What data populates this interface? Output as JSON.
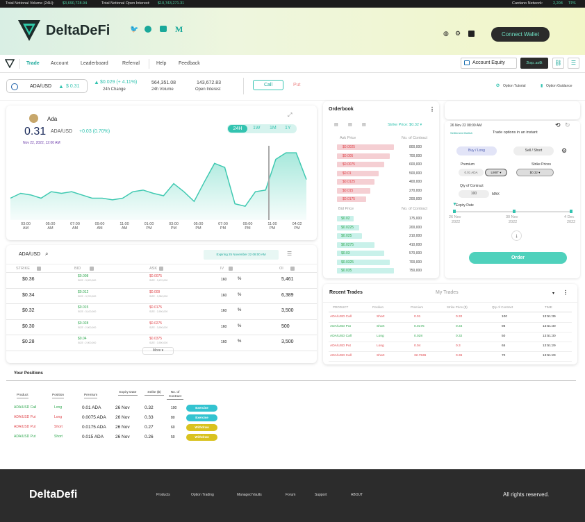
{
  "topbar": {
    "vol_label": "Total Notional Volume (24H):",
    "vol_value": "$3,690,728.94",
    "oi_label": "Total Notional Open Interest:",
    "oi_value": "$10,743,271.31",
    "network_label": "Cardano Network:",
    "tps_value": "2,208",
    "tps_label": "TPS"
  },
  "hero": {
    "brand": "DeltaDeFi",
    "connect": "Connect Wallet"
  },
  "nav": {
    "items": [
      "Trade",
      "Account",
      "Leaderboard",
      "Referral",
      "Help",
      "Feedback"
    ],
    "account_equity": "Account Equity",
    "wallet": "2kxp..ao8t"
  },
  "ticker": {
    "pair": "ADA/USD",
    "price": "$ 0.31",
    "change": "$0.029 (+ 4.11%)",
    "change_label": "24h Change",
    "volume": "564,351.08",
    "volume_label": "24h Volume",
    "oi": "143,672.83",
    "oi_label": "Open Interest",
    "call": "Call",
    "put": "Put",
    "tutorial": "Option Tutorial",
    "guidance": "Option Guidance"
  },
  "price_chart": {
    "asset": "Ada",
    "price": "0.31",
    "pair": "ADA/USD",
    "delta": "+0.03 (0.70%)",
    "date": "Nov 22, 2022, 12:00 AM",
    "ranges": [
      "24H",
      "1W",
      "1M",
      "1Y"
    ]
  },
  "chart_data": {
    "type": "area",
    "x": [
      "03:00 AM",
      "05:00 AM",
      "07:00 AM",
      "09:00 AM",
      "11:00 AM",
      "01:00 PM",
      "03:00 PM",
      "05:00 PM",
      "07:00 PM",
      "09:00 PM",
      "11:00 PM",
      "04:02 PM"
    ],
    "values": [
      0.262,
      0.268,
      0.266,
      0.262,
      0.27,
      0.268,
      0.27,
      0.266,
      0.262,
      0.262,
      0.26,
      0.262,
      0.27,
      0.272,
      0.268,
      0.265,
      0.28,
      0.27,
      0.258,
      0.282,
      0.305,
      0.3,
      0.255,
      0.252,
      0.27,
      0.272,
      0.31,
      0.318,
      0.318,
      0.285
    ],
    "series": []
  },
  "options": {
    "pair": "ADA/USD",
    "expiry": "Expiring 25 November 22 08:00 AM",
    "headers": [
      "STRIKE",
      "BID",
      "ASK",
      "IV",
      "OI"
    ],
    "rows": [
      {
        "strike": "$0.36",
        "bid": "$0.008",
        "bid_size": "SIZE : 3,200,000",
        "ask": "$0.0075",
        "ask_size": "SIZE : 3,470,000",
        "iv": "160",
        "pct": "%",
        "oi": "5,461"
      },
      {
        "strike": "$0.34",
        "bid": "$0.012",
        "bid_size": "SIZE : 3,700,000",
        "ask": "$0.009",
        "ask_size": "SIZE : 3,350,000",
        "iv": "160",
        "pct": "%",
        "oi": "6,389"
      },
      {
        "strike": "$0.32",
        "bid": "$0.015",
        "bid_size": "SIZE : 3,100,000",
        "ask": "$0.0175",
        "ask_size": "SIZE : 2,900,000",
        "iv": "160",
        "pct": "%",
        "oi": "3,500"
      },
      {
        "strike": "$0.30",
        "bid": "$0.028",
        "bid_size": "SIZE : 2,900,000",
        "ask": "$0.0275",
        "ask_size": "SIZE : 3,900,000",
        "iv": "160",
        "pct": "%",
        "oi": "500"
      },
      {
        "strike": "$0.28",
        "bid": "$0.04",
        "bid_size": "SIZE : 2,900,000",
        "ask": "$0.0375",
        "ask_size": "SIZE : 3,900,000",
        "iv": "160",
        "pct": "%",
        "oi": "3,500"
      }
    ],
    "more": "More"
  },
  "orderbook": {
    "title": "Orderbook",
    "strike": "Strike Price: $0.32",
    "ask_header": "Ask Price",
    "contract_header": "No. of Contract",
    "bid_header": "Bid Price",
    "asks": [
      {
        "p": "$0.0025",
        "n": "800,000",
        "w": 82
      },
      {
        "p": "$0.005",
        "n": "700,000",
        "w": 76
      },
      {
        "p": "$0.0075",
        "n": "600,000",
        "w": 68
      },
      {
        "p": "$0.01",
        "n": "500,000",
        "w": 60
      },
      {
        "p": "$0.0125",
        "n": "400,000",
        "w": 54
      },
      {
        "p": "$0.015",
        "n": "270,000",
        "w": 48
      },
      {
        "p": "$0.0175",
        "n": "200,000",
        "w": 42
      }
    ],
    "bids": [
      {
        "p": "$0.02",
        "n": "175,000",
        "w": 24
      },
      {
        "p": "$0.0225",
        "n": "200,000",
        "w": 32
      },
      {
        "p": "$0.025",
        "n": "210,000",
        "w": 36
      },
      {
        "p": "$0.0275",
        "n": "410,000",
        "w": 54
      },
      {
        "p": "$0.03",
        "n": "570,000",
        "w": 68
      },
      {
        "p": "$0.0325",
        "n": "700,000",
        "w": 76
      },
      {
        "p": "$0.035",
        "n": "750,000",
        "w": 82
      }
    ]
  },
  "order": {
    "date": "26 Nov 22 08:00 AM",
    "tagline": "Settlement Bullish",
    "subtitle": "Trade options in an instant",
    "buy": "Buy / Long",
    "sell": "Sell / Short",
    "premium_label": "Premium",
    "premium_value": "0.01 ADA",
    "limit": "LIMIT",
    "strike_label": "Strike Prices",
    "strike_value": "$0.32",
    "qty_label": "Qty of Contract",
    "qty_value": "100",
    "max": "MAX",
    "expiry_label": "Expiry Date",
    "dates": [
      {
        "d": "26 Nov",
        "y": "2022"
      },
      {
        "d": "30 Nov",
        "y": "2022"
      },
      {
        "d": "4 Dec",
        "y": "2022"
      }
    ],
    "order_btn": "Order"
  },
  "trades": {
    "title": "Recent Trades",
    "my": "My Trades",
    "headers": [
      "PRODUCT",
      "Position",
      "Premium",
      "Strike Price ($)",
      "Qty of Contract",
      "TIME"
    ],
    "rows": [
      {
        "product": "ADA/USD Call",
        "pos": "Short",
        "premium": "0.01",
        "strike": "0.32",
        "qty": "100",
        "time": "13:51:39",
        "pc": "red"
      },
      {
        "product": "ADA/USD Put",
        "pos": "Short",
        "premium": "0.0175",
        "strike": "0.34",
        "qty": "98",
        "time": "13:51:30",
        "pc": "green"
      },
      {
        "product": "ADA/USD Call",
        "pos": "Long",
        "premium": "0.028",
        "strike": "0.32",
        "qty": "50",
        "time": "13:51:30",
        "pc": "green"
      },
      {
        "product": "ADA/USD Put",
        "pos": "Long",
        "premium": "0.04",
        "strike": "0.3",
        "qty": "65",
        "time": "13:51:29",
        "pc": "red"
      },
      {
        "product": "ADA/USD Call",
        "pos": "Short",
        "premium": "32.7536",
        "strike": "0.36",
        "qty": "70",
        "time": "13:51:29",
        "pc": "red"
      }
    ]
  },
  "positions": {
    "title": "Your Positions",
    "headers": [
      "Product",
      "Position",
      "Premium",
      "Expiry Date",
      "Strike ($)",
      "No. of Contract"
    ],
    "rows": [
      {
        "product": "ADA/USD Call",
        "pos": "Long",
        "premium": "0.01 ADA",
        "expiry": "26 Nov",
        "strike": "0.32",
        "qty": "100",
        "action": "Exercise",
        "pc": "green"
      },
      {
        "product": "ADA/USD Put",
        "pos": "Long",
        "premium": "0.0075 ADA",
        "expiry": "26 Nov",
        "strike": "0.33",
        "qty": "80",
        "action": "Exercise",
        "pc": "red"
      },
      {
        "product": "ADA/USD Put",
        "pos": "Short",
        "premium": "0.0175 ADA",
        "expiry": "26 Nov",
        "strike": "0.27",
        "qty": "60",
        "action": "Withdraw",
        "pc": "red"
      },
      {
        "product": "ADA/USD Put",
        "pos": "Short",
        "premium": "0.015 ADA",
        "expiry": "26 Nov",
        "strike": "0.26",
        "qty": "50",
        "action": "Withdraw",
        "pc": "green"
      }
    ]
  },
  "footer": {
    "brand": "DeltaDefi",
    "links": [
      "Products",
      "Option Trading",
      "Managed Vaults",
      "Forum",
      "Support",
      "ABOUT"
    ],
    "rights": "All rights reserved."
  },
  "colors": {
    "teal": "#33c3b0",
    "ask": "#f5cfd3",
    "bid": "#c9f1ea",
    "red": "#e0474c",
    "green": "#2fa84f",
    "yellow": "#d9c21f"
  }
}
